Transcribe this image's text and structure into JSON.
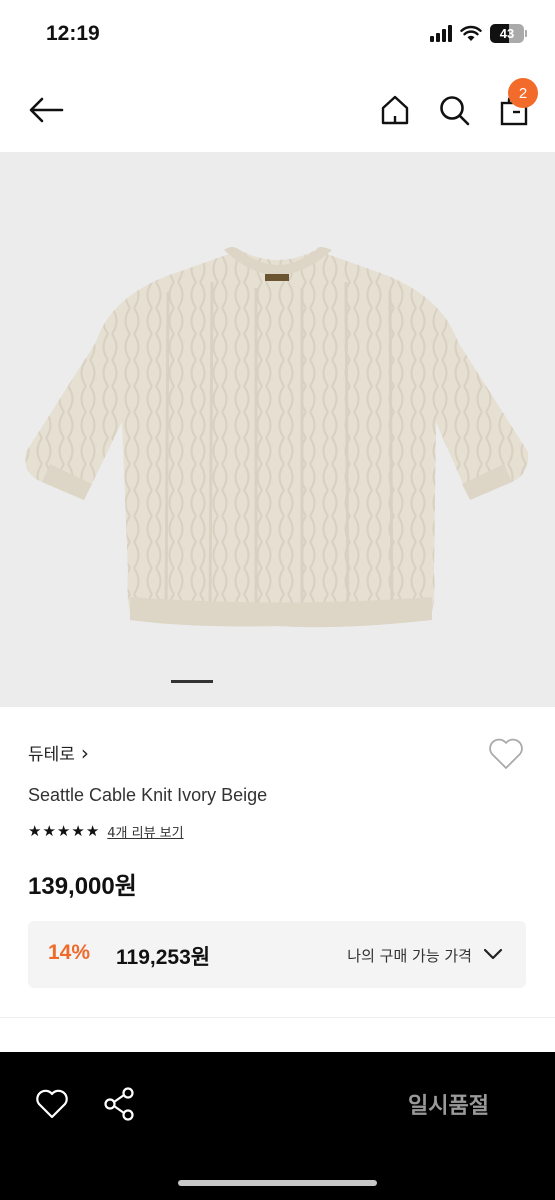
{
  "status_bar": {
    "time": "12:19",
    "battery": "43"
  },
  "header": {
    "cart_count": "2"
  },
  "product": {
    "brand": "듀테로",
    "brand_chevron": "›",
    "name": "Seattle Cable Knit Ivory Beige",
    "rating_stars": 5,
    "review_link": "4개 리뷰 보기",
    "price": "139,000원",
    "discount_rate": "14%",
    "discount_price": "119,253원",
    "my_price_label": "나의 구매 가능 가격"
  },
  "bottom_bar": {
    "status_label": "일시품절"
  },
  "icons": {
    "back": "arrow-left-icon",
    "home": "home-icon",
    "search": "search-icon",
    "cart": "shopping-bag-icon",
    "wishlist": "heart-icon",
    "share": "share-icon",
    "expand": "chevron-down-icon"
  },
  "colors": {
    "accent": "#f26b2a",
    "discount": "#f06a2a",
    "bottom_bar": "#000000",
    "hero_bg": "#ececec"
  }
}
